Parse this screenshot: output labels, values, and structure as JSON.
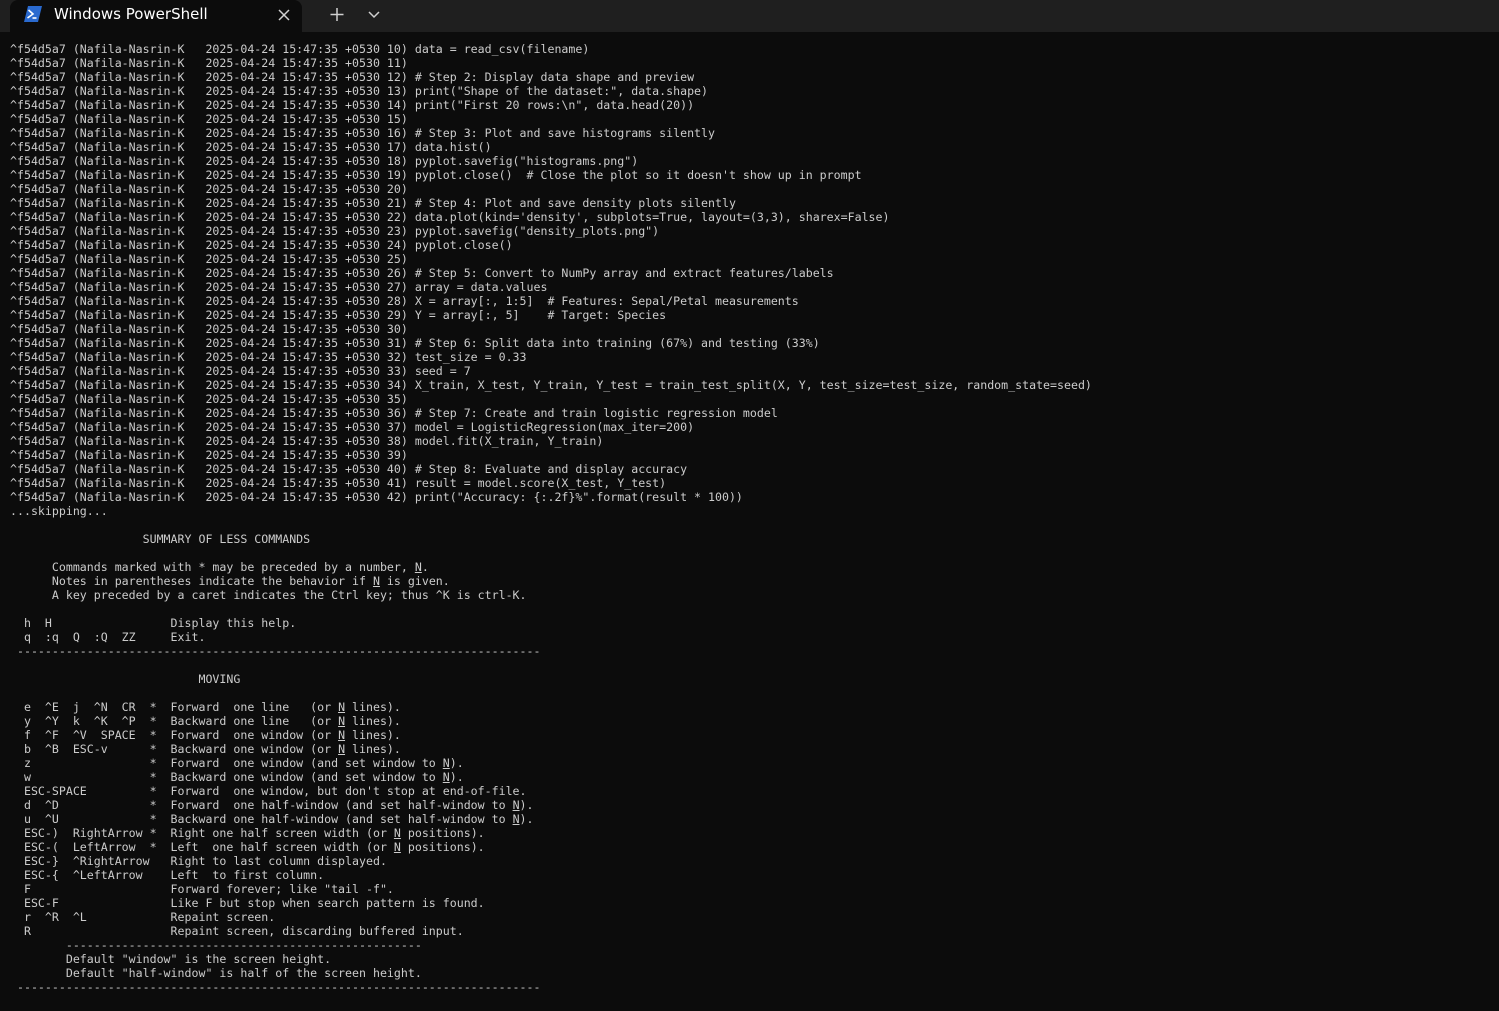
{
  "window": {
    "tab_title": "Windows PowerShell",
    "icons": {
      "tab": "powershell-icon",
      "close": "close-icon",
      "new_tab": "plus-icon",
      "dropdown": "chevron-down-icon"
    },
    "colors": {
      "titlebar": "#1f1f1f",
      "terminal_bg": "#0c0c0c",
      "text": "#cccccc",
      "powershell_blue": "#2a6acf"
    }
  },
  "terminal": {
    "lines": [
      "^f54d5a7 (Nafila-Nasrin-K   2025-04-24 15:47:35 +0530 10) data = read_csv(filename)",
      "^f54d5a7 (Nafila-Nasrin-K   2025-04-24 15:47:35 +0530 11)",
      "^f54d5a7 (Nafila-Nasrin-K   2025-04-24 15:47:35 +0530 12) # Step 2: Display data shape and preview",
      "^f54d5a7 (Nafila-Nasrin-K   2025-04-24 15:47:35 +0530 13) print(\"Shape of the dataset:\", data.shape)",
      "^f54d5a7 (Nafila-Nasrin-K   2025-04-24 15:47:35 +0530 14) print(\"First 20 rows:\\n\", data.head(20))",
      "^f54d5a7 (Nafila-Nasrin-K   2025-04-24 15:47:35 +0530 15)",
      "^f54d5a7 (Nafila-Nasrin-K   2025-04-24 15:47:35 +0530 16) # Step 3: Plot and save histograms silently",
      "^f54d5a7 (Nafila-Nasrin-K   2025-04-24 15:47:35 +0530 17) data.hist()",
      "^f54d5a7 (Nafila-Nasrin-K   2025-04-24 15:47:35 +0530 18) pyplot.savefig(\"histograms.png\")",
      "^f54d5a7 (Nafila-Nasrin-K   2025-04-24 15:47:35 +0530 19) pyplot.close()  # Close the plot so it doesn't show up in prompt",
      "^f54d5a7 (Nafila-Nasrin-K   2025-04-24 15:47:35 +0530 20)",
      "^f54d5a7 (Nafila-Nasrin-K   2025-04-24 15:47:35 +0530 21) # Step 4: Plot and save density plots silently",
      "^f54d5a7 (Nafila-Nasrin-K   2025-04-24 15:47:35 +0530 22) data.plot(kind='density', subplots=True, layout=(3,3), sharex=False)",
      "^f54d5a7 (Nafila-Nasrin-K   2025-04-24 15:47:35 +0530 23) pyplot.savefig(\"density_plots.png\")",
      "^f54d5a7 (Nafila-Nasrin-K   2025-04-24 15:47:35 +0530 24) pyplot.close()",
      "^f54d5a7 (Nafila-Nasrin-K   2025-04-24 15:47:35 +0530 25)",
      "^f54d5a7 (Nafila-Nasrin-K   2025-04-24 15:47:35 +0530 26) # Step 5: Convert to NumPy array and extract features/labels",
      "^f54d5a7 (Nafila-Nasrin-K   2025-04-24 15:47:35 +0530 27) array = data.values",
      "^f54d5a7 (Nafila-Nasrin-K   2025-04-24 15:47:35 +0530 28) X = array[:, 1:5]  # Features: Sepal/Petal measurements",
      "^f54d5a7 (Nafila-Nasrin-K   2025-04-24 15:47:35 +0530 29) Y = array[:, 5]    # Target: Species",
      "^f54d5a7 (Nafila-Nasrin-K   2025-04-24 15:47:35 +0530 30)",
      "^f54d5a7 (Nafila-Nasrin-K   2025-04-24 15:47:35 +0530 31) # Step 6: Split data into training (67%) and testing (33%)",
      "^f54d5a7 (Nafila-Nasrin-K   2025-04-24 15:47:35 +0530 32) test_size = 0.33",
      "^f54d5a7 (Nafila-Nasrin-K   2025-04-24 15:47:35 +0530 33) seed = 7",
      "^f54d5a7 (Nafila-Nasrin-K   2025-04-24 15:47:35 +0530 34) X_train, X_test, Y_train, Y_test = train_test_split(X, Y, test_size=test_size, random_state=seed)",
      "^f54d5a7 (Nafila-Nasrin-K   2025-04-24 15:47:35 +0530 35)",
      "^f54d5a7 (Nafila-Nasrin-K   2025-04-24 15:47:35 +0530 36) # Step 7: Create and train logistic regression model",
      "^f54d5a7 (Nafila-Nasrin-K   2025-04-24 15:47:35 +0530 37) model = LogisticRegression(max_iter=200)",
      "^f54d5a7 (Nafila-Nasrin-K   2025-04-24 15:47:35 +0530 38) model.fit(X_train, Y_train)",
      "^f54d5a7 (Nafila-Nasrin-K   2025-04-24 15:47:35 +0530 39)",
      "^f54d5a7 (Nafila-Nasrin-K   2025-04-24 15:47:35 +0530 40) # Step 8: Evaluate and display accuracy",
      "^f54d5a7 (Nafila-Nasrin-K   2025-04-24 15:47:35 +0530 41) result = model.score(X_test, Y_test)",
      "^f54d5a7 (Nafila-Nasrin-K   2025-04-24 15:47:35 +0530 42) print(\"Accuracy: {:.2f}%\".format(result * 100))",
      "...skipping...",
      "",
      "                   SUMMARY OF LESS COMMANDS",
      "",
      "      Commands marked with * may be preceded by a number, [[N]].",
      "      Notes in parentheses indicate the behavior if [[N]] is given.",
      "      A key preceded by a caret indicates the Ctrl key; thus ^K is ctrl-K.",
      "",
      "  h  H                 Display this help.",
      "  q  :q  Q  :Q  ZZ     Exit.",
      " ---------------------------------------------------------------------------",
      "",
      "                           MOVING",
      "",
      "  e  ^E  j  ^N  CR  *  Forward  one line   (or [[N]] lines).",
      "  y  ^Y  k  ^K  ^P  *  Backward one line   (or [[N]] lines).",
      "  f  ^F  ^V  SPACE  *  Forward  one window (or [[N]] lines).",
      "  b  ^B  ESC-v      *  Backward one window (or [[N]] lines).",
      "  z                 *  Forward  one window (and set window to [[N]]).",
      "  w                 *  Backward one window (and set window to [[N]]).",
      "  ESC-SPACE         *  Forward  one window, but don't stop at end-of-file.",
      "  d  ^D             *  Forward  one half-window (and set half-window to [[N]]).",
      "  u  ^U             *  Backward one half-window (and set half-window to [[N]]).",
      "  ESC-)  RightArrow *  Right one half screen width (or [[N]] positions).",
      "  ESC-(  LeftArrow  *  Left  one half screen width (or [[N]] positions).",
      "  ESC-}  ^RightArrow   Right to last column displayed.",
      "  ESC-{  ^LeftArrow    Left  to first column.",
      "  F                    Forward forever; like \"tail -f\".",
      "  ESC-F                Like F but stop when search pattern is found.",
      "  r  ^R  ^L            Repaint screen.",
      "  R                    Repaint screen, discarding buffered input.",
      "        ---------------------------------------------------",
      "        Default \"window\" is the screen height.",
      "        Default \"half-window\" is half of the screen height.",
      " ---------------------------------------------------------------------------"
    ]
  }
}
